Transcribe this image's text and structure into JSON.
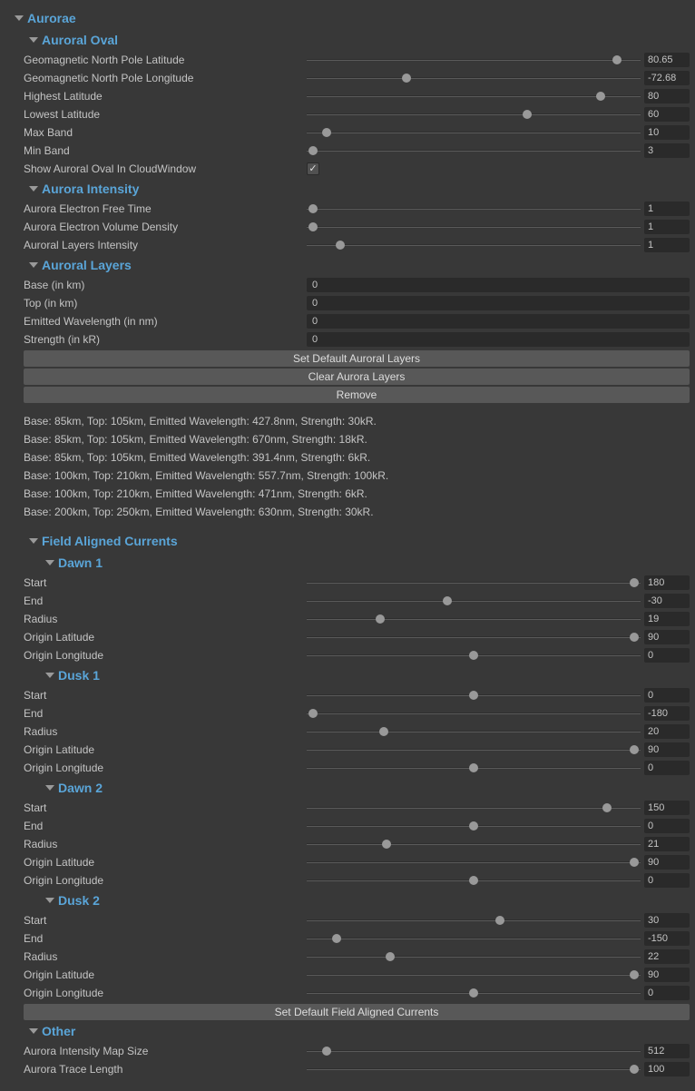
{
  "title": "Aurorae",
  "sections": {
    "auroral_oval": {
      "title": "Auroral Oval",
      "fields": {
        "north_lat": {
          "label": "Geomagnetic North Pole Latitude",
          "value": "80.65",
          "pct": 93
        },
        "north_lon": {
          "label": "Geomagnetic North Pole Longitude",
          "value": "-72.68",
          "pct": 30
        },
        "highest_lat": {
          "label": "Highest Latitude",
          "value": "80",
          "pct": 88
        },
        "lowest_lat": {
          "label": "Lowest Latitude",
          "value": "60",
          "pct": 66
        },
        "max_band": {
          "label": "Max Band",
          "value": "10",
          "pct": 6
        },
        "min_band": {
          "label": "Min Band",
          "value": "3",
          "pct": 2
        },
        "show_oval": {
          "label": "Show Auroral Oval In CloudWindow",
          "checked": true
        }
      }
    },
    "intensity": {
      "title": "Aurora Intensity",
      "fields": {
        "free_time": {
          "label": "Aurora Electron Free Time",
          "value": "1",
          "pct": 2
        },
        "vol_dens": {
          "label": "Aurora Electron Volume Density",
          "value": "1",
          "pct": 2
        },
        "layers_i": {
          "label": "Auroral Layers Intensity",
          "value": "1",
          "pct": 10
        }
      }
    },
    "layers": {
      "title": "Auroral Layers",
      "fields": {
        "base": {
          "label": "Base (in km)",
          "value": "0"
        },
        "top": {
          "label": "Top (in km)",
          "value": "0"
        },
        "emitted": {
          "label": "Emitted Wavelength (in nm)",
          "value": "0"
        },
        "strength": {
          "label": "Strength (in kR)",
          "value": "0"
        }
      },
      "buttons": {
        "set_default": "Set Default Auroral Layers",
        "clear": "Clear Aurora Layers",
        "remove": "Remove"
      },
      "list": [
        "Base: 85km, Top: 105km, Emitted Wavelength: 427.8nm, Strength: 30kR.",
        "Base: 85km, Top: 105km, Emitted Wavelength: 670nm, Strength: 18kR.",
        "Base: 85km, Top: 105km, Emitted Wavelength: 391.4nm, Strength: 6kR.",
        "Base: 100km, Top: 210km, Emitted Wavelength: 557.7nm, Strength: 100kR.",
        "Base: 100km, Top: 210km, Emitted Wavelength: 471nm, Strength: 6kR.",
        "Base: 200km, Top: 250km, Emitted Wavelength: 630nm, Strength: 30kR."
      ]
    },
    "fac": {
      "title": "Field Aligned Currents",
      "groups": {
        "dawn1": {
          "title": "Dawn 1",
          "fields": {
            "start": {
              "label": "Start",
              "value": "180",
              "pct": 98
            },
            "end": {
              "label": "End",
              "value": "-30",
              "pct": 42
            },
            "radius": {
              "label": "Radius",
              "value": "19",
              "pct": 22
            },
            "olat": {
              "label": "Origin Latitude",
              "value": "90",
              "pct": 98
            },
            "olon": {
              "label": "Origin Longitude",
              "value": "0",
              "pct": 50
            }
          }
        },
        "dusk1": {
          "title": "Dusk 1",
          "fields": {
            "start": {
              "label": "Start",
              "value": "0",
              "pct": 50
            },
            "end": {
              "label": "End",
              "value": "-180",
              "pct": 2
            },
            "radius": {
              "label": "Radius",
              "value": "20",
              "pct": 23
            },
            "olat": {
              "label": "Origin Latitude",
              "value": "90",
              "pct": 98
            },
            "olon": {
              "label": "Origin Longitude",
              "value": "0",
              "pct": 50
            }
          }
        },
        "dawn2": {
          "title": "Dawn 2",
          "fields": {
            "start": {
              "label": "Start",
              "value": "150",
              "pct": 90
            },
            "end": {
              "label": "End",
              "value": "0",
              "pct": 50
            },
            "radius": {
              "label": "Radius",
              "value": "21",
              "pct": 24
            },
            "olat": {
              "label": "Origin Latitude",
              "value": "90",
              "pct": 98
            },
            "olon": {
              "label": "Origin Longitude",
              "value": "0",
              "pct": 50
            }
          }
        },
        "dusk2": {
          "title": "Dusk 2",
          "fields": {
            "start": {
              "label": "Start",
              "value": "30",
              "pct": 58
            },
            "end": {
              "label": "End",
              "value": "-150",
              "pct": 9
            },
            "radius": {
              "label": "Radius",
              "value": "22",
              "pct": 25
            },
            "olat": {
              "label": "Origin Latitude",
              "value": "90",
              "pct": 98
            },
            "olon": {
              "label": "Origin Longitude",
              "value": "0",
              "pct": 50
            }
          }
        }
      },
      "button": "Set Default Field Aligned Currents"
    },
    "other": {
      "title": "Other",
      "fields": {
        "map_size": {
          "label": "Aurora Intensity Map Size",
          "value": "512",
          "pct": 6
        },
        "trace_len": {
          "label": "Aurora Trace Length",
          "value": "100",
          "pct": 98
        }
      }
    }
  }
}
